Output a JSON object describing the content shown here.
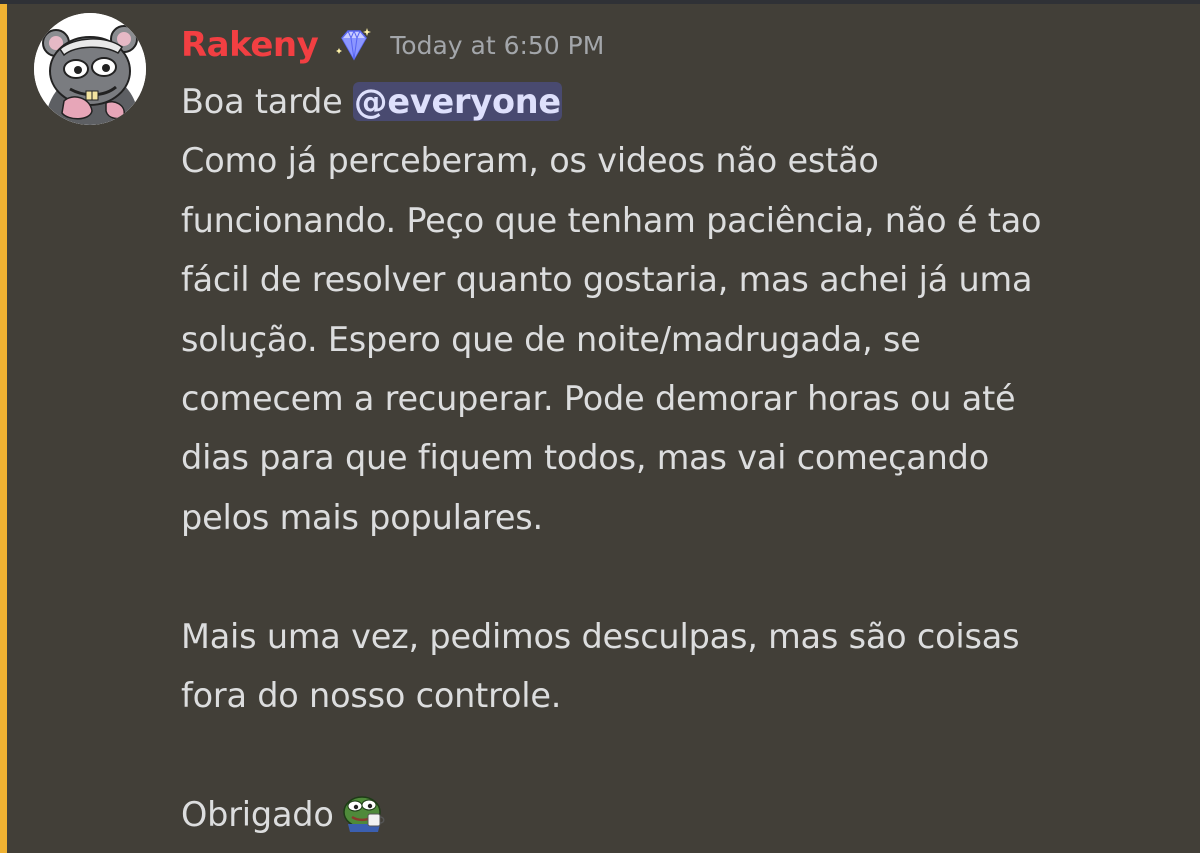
{
  "message": {
    "author": {
      "username": "Rakeny",
      "avatar_icon": "pepe-avatar-icon",
      "badge_icon": "diamond-badge-icon",
      "username_color": "#f23f42"
    },
    "timestamp": "Today at 6:50 PM",
    "mention_accent": "#f0b232",
    "lines": {
      "l1_text": "Boa tarde ",
      "l1_mention": "@everyone",
      "l2": "Como já perceberam, os videos não estão",
      "l3": "funcionando. Peço que tenham paciência, não é tao",
      "l4": "fácil de resolver quanto gostaria, mas achei já uma",
      "l5": "solução. Espero que de noite/madrugada, se",
      "l6": "comecem a recuperar. Pode demorar horas ou até",
      "l7": "dias para que fiquem todos, mas vai começando",
      "l8": "pelos mais populares.",
      "l10": "Mais uma vez, pedimos desculpas, mas são coisas",
      "l11": "fora do nosso controle.",
      "l13_text": "Obrigado",
      "l13_emoji": "pepe-coffee-emoji-icon"
    }
  }
}
